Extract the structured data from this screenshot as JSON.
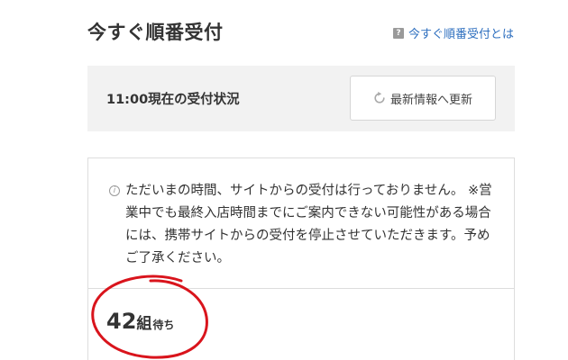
{
  "header": {
    "title": "今すぐ順番受付",
    "help_icon_glyph": "?",
    "help_link": "今すぐ順番受付とは"
  },
  "status": {
    "label": "11:00現在の受付状況",
    "refresh_button": "最新情報へ更新"
  },
  "notice": {
    "info_icon_glyph": "i",
    "text": "ただいまの時間、サイトからの受付は行っておりません。 ※営業中でも最終入店時間までにご案内できない可能性がある場合には、携帯サイトからの受付を停止させていただきます。予めご了承ください。"
  },
  "wait": {
    "number": "42",
    "unit": "組",
    "suffix": "待ち"
  },
  "colors": {
    "link": "#2e6fbf",
    "annotation_circle": "#d9141c",
    "status_bg": "#f2f2f2"
  }
}
